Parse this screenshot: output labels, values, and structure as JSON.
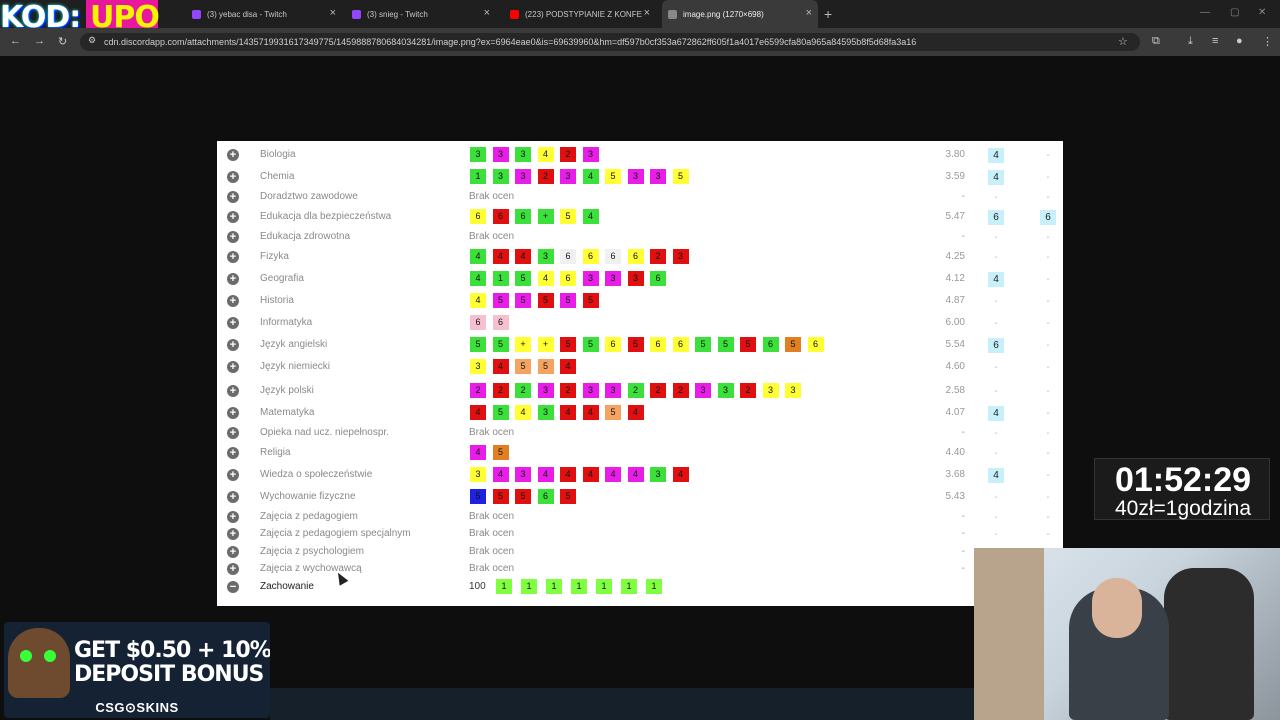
{
  "browser": {
    "tabs": [
      {
        "label": "(3) yebac disa - Twitch",
        "icon": "twitch-icon",
        "color": "#9146ff"
      },
      {
        "label": "(3) snieg - Twitch",
        "icon": "twitch-icon",
        "color": "#9146ff"
      },
      {
        "label": "(223) PODSTYPIANIE Z KONFE",
        "icon": "youtube-icon",
        "color": "#ff0000"
      },
      {
        "label": "image.png (1270×698)",
        "icon": "image-icon",
        "color": "#888888"
      }
    ],
    "url": "cdn.discordapp.com/attachments/1435719931617349775/1459888780684034281/image.png?ex=6964eae0&is=69639960&hm=df597b0cf353a672862ff605f1a4017e6599cfa80a965a84595b8f5d68fa3a16"
  },
  "overlay": {
    "logo_kod": "KOD:",
    "logo_upo": "UPO",
    "timer": "01:52:29",
    "rate": "40zł=1godzina",
    "ad_line1": "GET $0.50 + 10%",
    "ad_line2": "DEPOSIT BONUS",
    "ad_brand": "CSG⊙SKINS"
  },
  "subjects": [
    {
      "name": "Biologia",
      "grades": [
        [
          "3",
          "g"
        ],
        [
          "3",
          "m"
        ],
        [
          "3",
          "g"
        ],
        [
          "4",
          "y"
        ],
        [
          "2",
          "r"
        ],
        [
          "3",
          "m"
        ]
      ],
      "avg": "3.80",
      "pred": "4",
      "final": "-"
    },
    {
      "name": "Chemia",
      "grades": [
        [
          "1",
          "g"
        ],
        [
          "3",
          "g"
        ],
        [
          "3",
          "m"
        ],
        [
          "2",
          "r"
        ],
        [
          "3",
          "m"
        ],
        [
          "4",
          "g"
        ],
        [
          "5",
          "y"
        ],
        [
          "3",
          "m"
        ],
        [
          "3",
          "m"
        ],
        [
          "5",
          "y"
        ]
      ],
      "avg": "3.59",
      "pred": "4",
      "final": "-"
    },
    {
      "name": "Doradztwo zawodowe",
      "none": "Brak ocen",
      "avg": "-",
      "pred": "-",
      "final": "-"
    },
    {
      "name": "Edukacja dla bezpieczeństwa",
      "grades": [
        [
          "6",
          "y"
        ],
        [
          "6",
          "r"
        ],
        [
          "6",
          "g"
        ],
        [
          "+",
          "g"
        ],
        [
          "5",
          "y"
        ],
        [
          "4",
          "g"
        ]
      ],
      "avg": "5.47",
      "pred": "6",
      "final": "6"
    },
    {
      "name": "Edukacja zdrowotna",
      "none": "Brak ocen",
      "avg": "-",
      "pred": "-",
      "final": "-"
    },
    {
      "name": "Fizyka",
      "grades": [
        [
          "4",
          "g"
        ],
        [
          "4",
          "r"
        ],
        [
          "4",
          "r"
        ],
        [
          "3",
          "g"
        ],
        [
          "6",
          "w"
        ],
        [
          "6",
          "y"
        ],
        [
          "6",
          "w"
        ],
        [
          "6",
          "y"
        ],
        [
          "2",
          "r"
        ],
        [
          "3",
          "r"
        ]
      ],
      "avg": "4.25",
      "pred": "-",
      "final": "-"
    },
    {
      "name": "Geografia",
      "grades": [
        [
          "4",
          "g"
        ],
        [
          "1",
          "g"
        ],
        [
          "5",
          "g"
        ],
        [
          "4",
          "y"
        ],
        [
          "6",
          "y"
        ],
        [
          "3",
          "m"
        ],
        [
          "3",
          "m"
        ],
        [
          "3",
          "r"
        ],
        [
          "6",
          "g"
        ]
      ],
      "avg": "4.12",
      "pred": "4",
      "final": "-"
    },
    {
      "name": "Historia",
      "grades": [
        [
          "4",
          "y"
        ],
        [
          "5",
          "m"
        ],
        [
          "5",
          "m"
        ],
        [
          "5",
          "r"
        ],
        [
          "5",
          "m"
        ],
        [
          "5",
          "r"
        ]
      ],
      "avg": "4.87",
      "pred": "-",
      "final": "-"
    },
    {
      "name": "Informatyka",
      "grades": [
        [
          "6",
          "p"
        ],
        [
          "6",
          "p"
        ]
      ],
      "avg": "6.00",
      "pred": "-",
      "final": "-"
    },
    {
      "name": "Język angielski",
      "grades": [
        [
          "5",
          "g"
        ],
        [
          "5",
          "g"
        ],
        [
          "+",
          "y"
        ],
        [
          "+",
          "y"
        ],
        [
          "5",
          "r"
        ],
        [
          "5",
          "g"
        ],
        [
          "6",
          "y"
        ],
        [
          "5",
          "r"
        ],
        [
          "6",
          "y"
        ],
        [
          "6",
          "y"
        ],
        [
          "5",
          "g"
        ],
        [
          "5",
          "g"
        ],
        [
          "5",
          "r"
        ],
        [
          "6",
          "g"
        ],
        [
          "5",
          "dk"
        ],
        [
          "6",
          "y"
        ]
      ],
      "avg": "5.54",
      "pred": "6",
      "final": "-"
    },
    {
      "name": "Język niemiecki",
      "grades": [
        [
          "3",
          "y"
        ],
        [
          "4",
          "r"
        ],
        [
          "5",
          "o"
        ],
        [
          "5",
          "o"
        ],
        [
          "4",
          "r"
        ]
      ],
      "avg": "4.60",
      "pred": "-",
      "final": "-"
    },
    {
      "name": "Język polski",
      "grades": [
        [
          "2",
          "m"
        ],
        [
          "2",
          "r"
        ],
        [
          "2",
          "g"
        ],
        [
          "3",
          "m"
        ],
        [
          "2",
          "r"
        ],
        [
          "3",
          "m"
        ],
        [
          "3",
          "m"
        ],
        [
          "2",
          "g"
        ],
        [
          "2",
          "r"
        ],
        [
          "2",
          "r"
        ],
        [
          "3",
          "m"
        ],
        [
          "3",
          "g"
        ],
        [
          "2",
          "r"
        ],
        [
          "3",
          "y"
        ],
        [
          "3",
          "y"
        ]
      ],
      "avg": "2.58",
      "pred": "-",
      "final": "-"
    },
    {
      "name": "Matematyka",
      "grades": [
        [
          "4",
          "r"
        ],
        [
          "5",
          "g"
        ],
        [
          "4",
          "y"
        ],
        [
          "3",
          "g"
        ],
        [
          "4",
          "r"
        ],
        [
          "4",
          "r"
        ],
        [
          "5",
          "o"
        ],
        [
          "4",
          "r"
        ]
      ],
      "avg": "4.07",
      "pred": "4",
      "final": "-"
    },
    {
      "name": "Opieka nad ucz. niepełnospr.",
      "none": "Brak ocen",
      "avg": "-",
      "pred": "-",
      "final": "-"
    },
    {
      "name": "Religia",
      "grades": [
        [
          "4",
          "m"
        ],
        [
          "5",
          "dk"
        ]
      ],
      "avg": "4.40",
      "pred": "-",
      "final": "-"
    },
    {
      "name": "Wiedza o społeczeństwie",
      "grades": [
        [
          "3",
          "y"
        ],
        [
          "4",
          "m"
        ],
        [
          "3",
          "m"
        ],
        [
          "4",
          "m"
        ],
        [
          "4",
          "r"
        ],
        [
          "4",
          "r"
        ],
        [
          "4",
          "m"
        ],
        [
          "4",
          "m"
        ],
        [
          "3",
          "g"
        ],
        [
          "4",
          "r"
        ]
      ],
      "avg": "3.68",
      "pred": "4",
      "final": "-"
    },
    {
      "name": "Wychowanie fizyczne",
      "grades": [
        [
          "5",
          "b"
        ],
        [
          "5",
          "r"
        ],
        [
          "5",
          "r"
        ],
        [
          "6",
          "g"
        ],
        [
          "5",
          "r"
        ]
      ],
      "avg": "5.43",
      "pred": "-",
      "final": "-"
    },
    {
      "name": "Zajęcia z pedagogiem",
      "none": "Brak ocen",
      "avg": "-",
      "pred": "-",
      "final": "-"
    },
    {
      "name": "Zajęcia z pedagogiem specjalnym",
      "none": "Brak ocen",
      "avg": "-",
      "pred": "-",
      "final": "-"
    },
    {
      "name": "Zajęcia z psychologiem",
      "none": "Brak ocen",
      "avg": "-",
      "pred": "-",
      "final": "-"
    },
    {
      "name": "Zajęcia z wychowawcą",
      "none": "Brak ocen",
      "avg": "-",
      "pred": "-",
      "final": "-"
    },
    {
      "name": "Zachowanie",
      "behavior": "100",
      "grades": [
        [
          "1",
          "l"
        ],
        [
          "1",
          "l"
        ],
        [
          "1",
          "l"
        ],
        [
          "1",
          "l"
        ],
        [
          "1",
          "l"
        ],
        [
          "1",
          "l"
        ],
        [
          "1",
          "l"
        ]
      ],
      "avg": "",
      "pred": "",
      "final": ""
    }
  ]
}
